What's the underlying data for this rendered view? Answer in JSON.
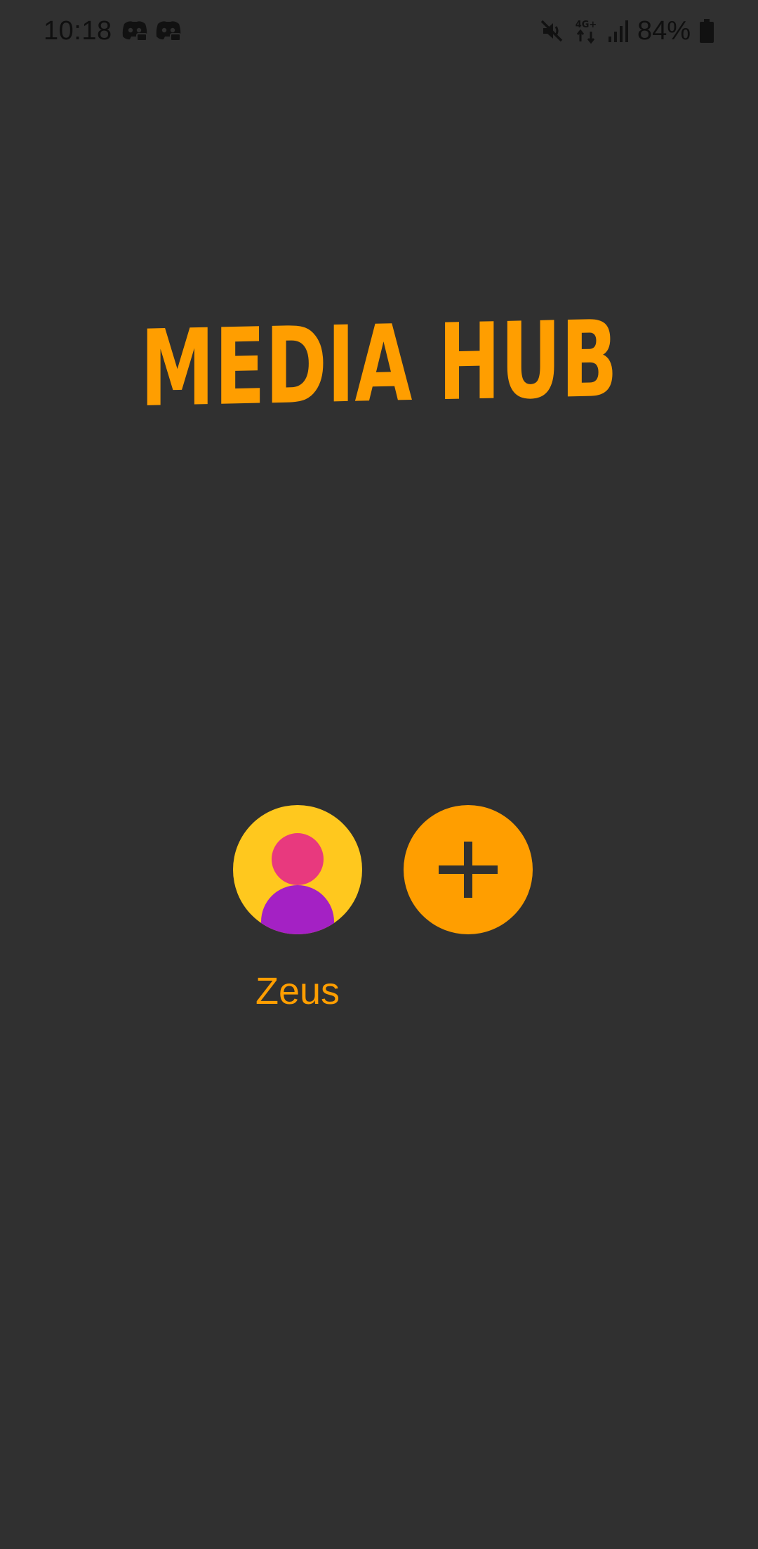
{
  "status_bar": {
    "time": "10:18",
    "notification_icons": [
      "discord-icon",
      "discord-icon"
    ],
    "system_icons": [
      "mute-icon",
      "4g-plus-data-icon",
      "signal-icon"
    ],
    "network_label": "4G+",
    "battery_percent": "84%"
  },
  "app": {
    "title": "MEDIA HUB",
    "colors": {
      "background": "#303030",
      "accent": "#FF9E00",
      "avatar_bg": "#FFC81E",
      "avatar_head": "#E8397E",
      "avatar_body": "#A421C4"
    }
  },
  "profiles": [
    {
      "name": "Zeus",
      "icon": "user-avatar-icon"
    }
  ],
  "add_profile": {
    "icon": "plus-icon"
  }
}
